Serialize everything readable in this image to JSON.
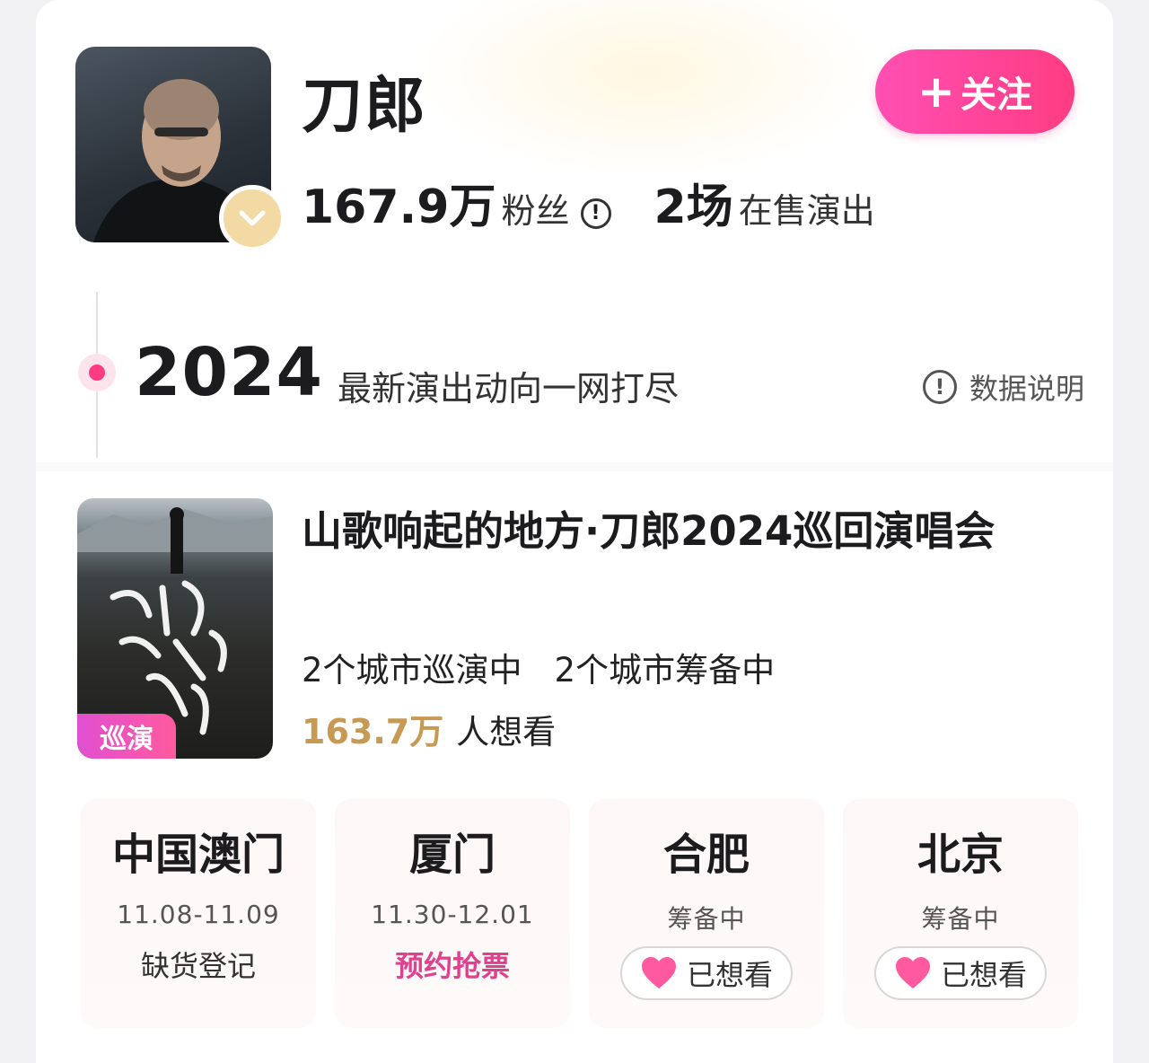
{
  "profile": {
    "name": "刀郎",
    "follow_label": "关注",
    "fans_count": "167.9万",
    "fans_label": "粉丝",
    "shows_count": "2场",
    "shows_label": "在售演出"
  },
  "timeline": {
    "year": "2024",
    "subtitle": "最新演出动向一网打尽",
    "data_note": "数据说明"
  },
  "event": {
    "poster_tag": "巡演",
    "title": "山歌响起的地方·刀郎2024巡回演唱会",
    "cities_touring": "2个城市巡演中",
    "cities_preparing": "2个城市筹备中",
    "want_count": "163.7万",
    "want_label": "人想看"
  },
  "cities": [
    {
      "name": "中国澳门",
      "date": "11.08-11.09",
      "status": "缺货登记"
    },
    {
      "name": "厦门",
      "date": "11.30-12.01",
      "status": "预约抢票"
    },
    {
      "name": "合肥",
      "date": "筹备中",
      "button": "已想看"
    },
    {
      "name": "北京",
      "date": "筹备中",
      "button": "已想看"
    }
  ],
  "colors": {
    "accent_pink": "#ff3c82",
    "want_gold": "#c79a54"
  },
  "icons": [
    "plus-icon",
    "info-icon",
    "verified-badge-icon",
    "heart-icon"
  ]
}
